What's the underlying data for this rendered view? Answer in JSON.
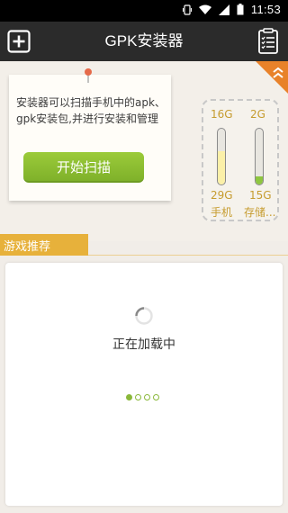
{
  "status_bar": {
    "time": "11:53"
  },
  "app_bar": {
    "title": "GPK安装器"
  },
  "scan_card": {
    "description": "安装器可以扫描手机中的apk、gpk安装包,并进行安装和管理",
    "scan_button": "开始扫描"
  },
  "storage": {
    "phone": {
      "free": "16G",
      "total": "29G",
      "label": "手机",
      "level": 0.6
    },
    "sd": {
      "free": "2G",
      "total": "15G",
      "label": "存储...",
      "level": 0.15
    }
  },
  "section": {
    "title": "游戏推荐"
  },
  "loading": {
    "text": "正在加载中",
    "page_count": 4,
    "current_page": 1
  },
  "colors": {
    "accent_green": "#8ab83a",
    "tag_yellow": "#e7b13b",
    "corner_orange": "#e8822a"
  }
}
